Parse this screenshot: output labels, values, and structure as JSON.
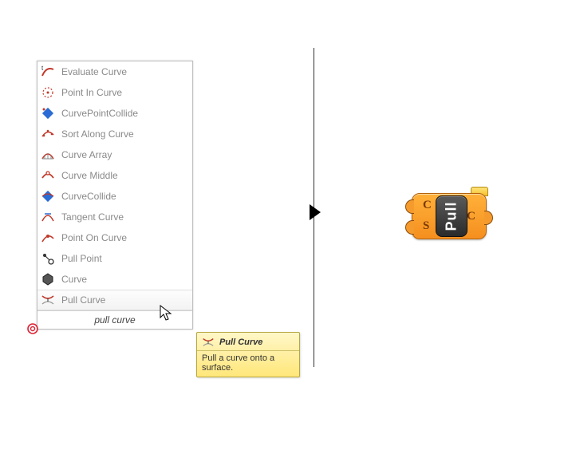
{
  "search": {
    "query": "pull curve",
    "items": [
      {
        "icon": "evaluate-curve-icon",
        "label": "Evaluate Curve"
      },
      {
        "icon": "point-in-curve-icon",
        "label": "Point In Curve"
      },
      {
        "icon": "curve-point-collide-icon",
        "label": "CurvePointCollide"
      },
      {
        "icon": "sort-along-curve-icon",
        "label": "Sort Along Curve"
      },
      {
        "icon": "curve-array-icon",
        "label": "Curve Array"
      },
      {
        "icon": "curve-middle-icon",
        "label": "Curve Middle"
      },
      {
        "icon": "curve-collide-icon",
        "label": "CurveCollide"
      },
      {
        "icon": "tangent-curve-icon",
        "label": "Tangent Curve"
      },
      {
        "icon": "point-on-curve-icon",
        "label": "Point On Curve"
      },
      {
        "icon": "pull-point-icon",
        "label": "Pull Point"
      },
      {
        "icon": "curve-icon",
        "label": "Curve"
      },
      {
        "icon": "pull-curve-icon",
        "label": "Pull Curve"
      }
    ],
    "highlight_index": 11
  },
  "tooltip": {
    "title": "Pull Curve",
    "description": "Pull a curve onto a surface."
  },
  "component": {
    "name": "Pull",
    "inputs": [
      {
        "label": "C"
      },
      {
        "label": "S"
      }
    ],
    "outputs": [
      {
        "label": "C"
      }
    ]
  }
}
